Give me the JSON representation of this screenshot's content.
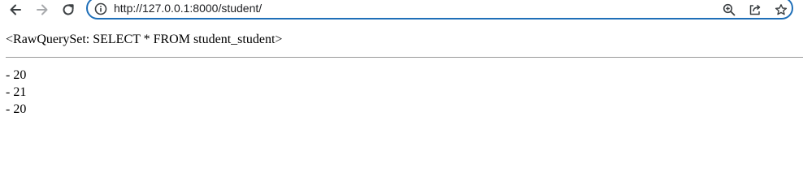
{
  "browser": {
    "url": "http://127.0.0.1:8000/student/",
    "icons": {
      "back": "arrow-left-icon",
      "forward": "arrow-right-icon",
      "reload": "reload-icon",
      "site_info": "info-icon",
      "zoom": "zoom-icon",
      "share": "share-icon",
      "bookmark": "star-icon"
    }
  },
  "page": {
    "queryset_repr": "<RawQuerySet: SELECT * FROM student_student>",
    "items": [
      "- 20",
      "- 21",
      "- 20"
    ]
  }
}
